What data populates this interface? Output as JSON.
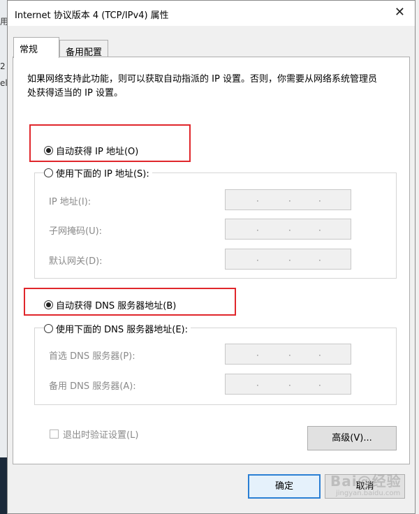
{
  "window": {
    "title": "Internet 协议版本 4 (TCP/IPv4) 属性",
    "close_glyph": "✕"
  },
  "background": {
    "fragments": [
      "用",
      "2",
      "el"
    ]
  },
  "tabs": [
    {
      "label": "常规",
      "active": true
    },
    {
      "label": "备用配置",
      "active": false
    }
  ],
  "description": "如果网络支持此功能，则可以获取自动指派的 IP 设置。否则，你需要从网络系统管理员处获得适当的 IP 设置。",
  "ip": {
    "auto_label": "自动获得 IP 地址(O)",
    "manual_label": "使用下面的 IP 地址(S):",
    "auto_selected": true,
    "fields": [
      {
        "label": "IP 地址(I):",
        "value": ""
      },
      {
        "label": "子网掩码(U):",
        "value": ""
      },
      {
        "label": "默认网关(D):",
        "value": ""
      }
    ]
  },
  "dns": {
    "auto_label": "自动获得 DNS 服务器地址(B)",
    "manual_label": "使用下面的 DNS 服务器地址(E):",
    "auto_selected": true,
    "fields": [
      {
        "label": "首选 DNS 服务器(P):",
        "value": ""
      },
      {
        "label": "备用 DNS 服务器(A):",
        "value": ""
      }
    ]
  },
  "validate_label": "退出时验证设置(L)",
  "validate_checked": false,
  "buttons": {
    "advanced": "高级(V)...",
    "ok": "确定",
    "cancel": "取消"
  },
  "watermark": {
    "text": "Bai@经验",
    "sub": "jingyan.baidu.com"
  },
  "colors": {
    "highlight_box": "#e0262b",
    "ok_border": "#2a7fd4"
  }
}
